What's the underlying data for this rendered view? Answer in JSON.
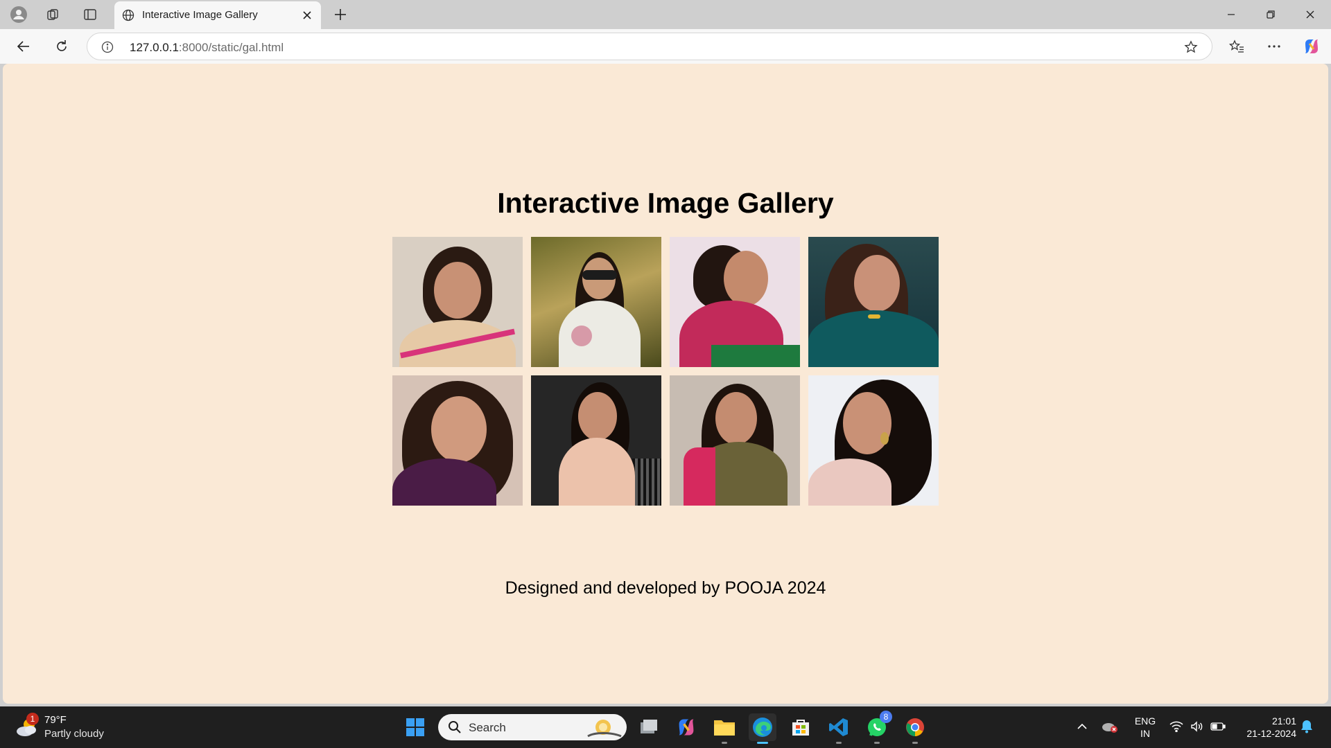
{
  "browser": {
    "tab": {
      "title": "Interactive Image Gallery"
    },
    "address": {
      "host": "127.0.0.1",
      "path": ":8000/static/gal.html"
    }
  },
  "page": {
    "title": "Interactive Image Gallery",
    "gallery": {
      "images": [
        {
          "alt": "photo-1",
          "bg": "#d9cfc3"
        },
        {
          "alt": "photo-2",
          "bg": "#9a8a3e"
        },
        {
          "alt": "photo-3",
          "bg": "#e9dfe4"
        },
        {
          "alt": "photo-4",
          "bg": "#1b3a3e"
        },
        {
          "alt": "photo-5",
          "bg": "#d9c4ba"
        },
        {
          "alt": "photo-6",
          "bg": "#2a2a2a"
        },
        {
          "alt": "photo-7",
          "bg": "#cbbfb4"
        },
        {
          "alt": "photo-8",
          "bg": "#eef1f5"
        }
      ]
    },
    "footer": "Designed and developed by POOJA 2024"
  },
  "taskbar": {
    "weather": {
      "badge": "1",
      "temp": "79°F",
      "desc": "Partly cloudy"
    },
    "search": {
      "label": "Search"
    },
    "whatsapp_badge": "8",
    "lang": {
      "line1": "ENG",
      "line2": "IN"
    },
    "clock": {
      "time": "21:01",
      "date": "21-12-2024"
    }
  },
  "colors": {
    "page_bg": "#fae9d6",
    "chrome_bg": "#cfcfcf",
    "taskbar_bg": "#1f1f1f",
    "accent": "#4cc2ff"
  }
}
